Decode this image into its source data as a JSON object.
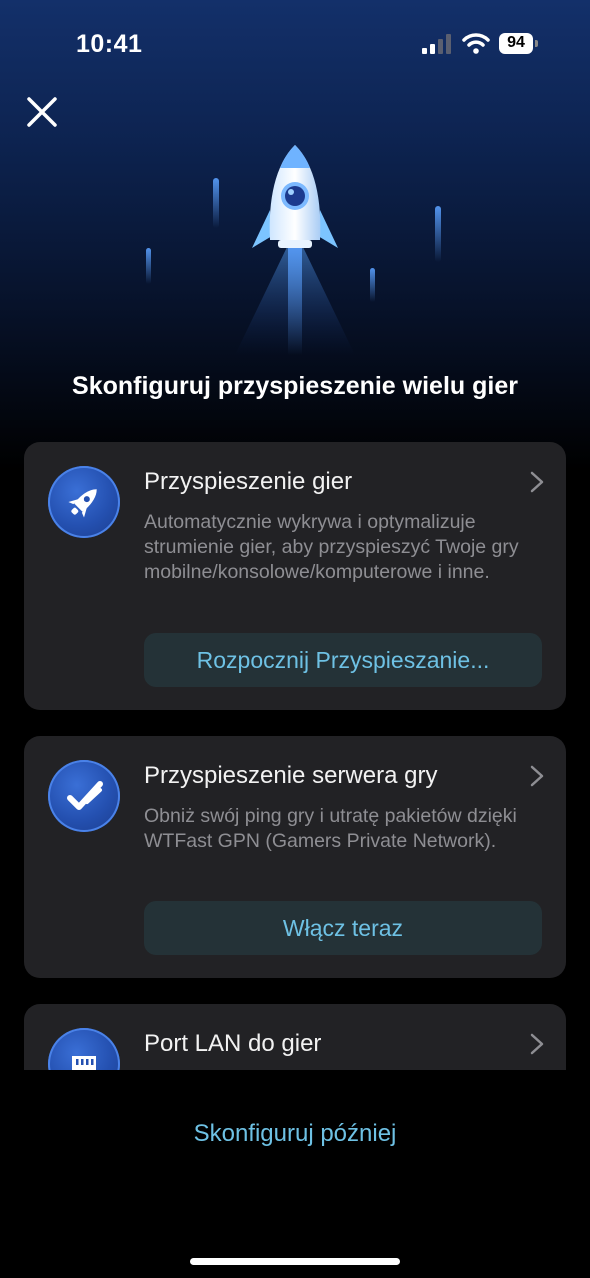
{
  "status_bar": {
    "time": "10:41",
    "battery": "94"
  },
  "header": {
    "title": "Skonfiguruj przyspieszenie wielu gier"
  },
  "cards": [
    {
      "icon": "rocket-icon",
      "title": "Przyspieszenie gier",
      "description": "Automatycznie wykrywa i optymalizuje strumienie gier, aby przyspieszyć Twoje gry mobilne/konsolowe/komputerowe i inne.",
      "action_label": "Rozpocznij Przyspieszanie..."
    },
    {
      "icon": "speed-check-icon",
      "title": "Przyspieszenie serwera gry",
      "description": "Obniż swój ping gry i utratę pakietów dzięki WTFast GPN (Gamers Private Network).",
      "action_label": "Włącz teraz"
    },
    {
      "icon": "ethernet-port-icon",
      "title": "Port LAN do gier"
    }
  ],
  "footer": {
    "later_label": "Skonfiguruj później"
  },
  "colors": {
    "accent": "#6ec1e4",
    "card_bg": "#222225",
    "icon_blue": "#2450b0"
  }
}
